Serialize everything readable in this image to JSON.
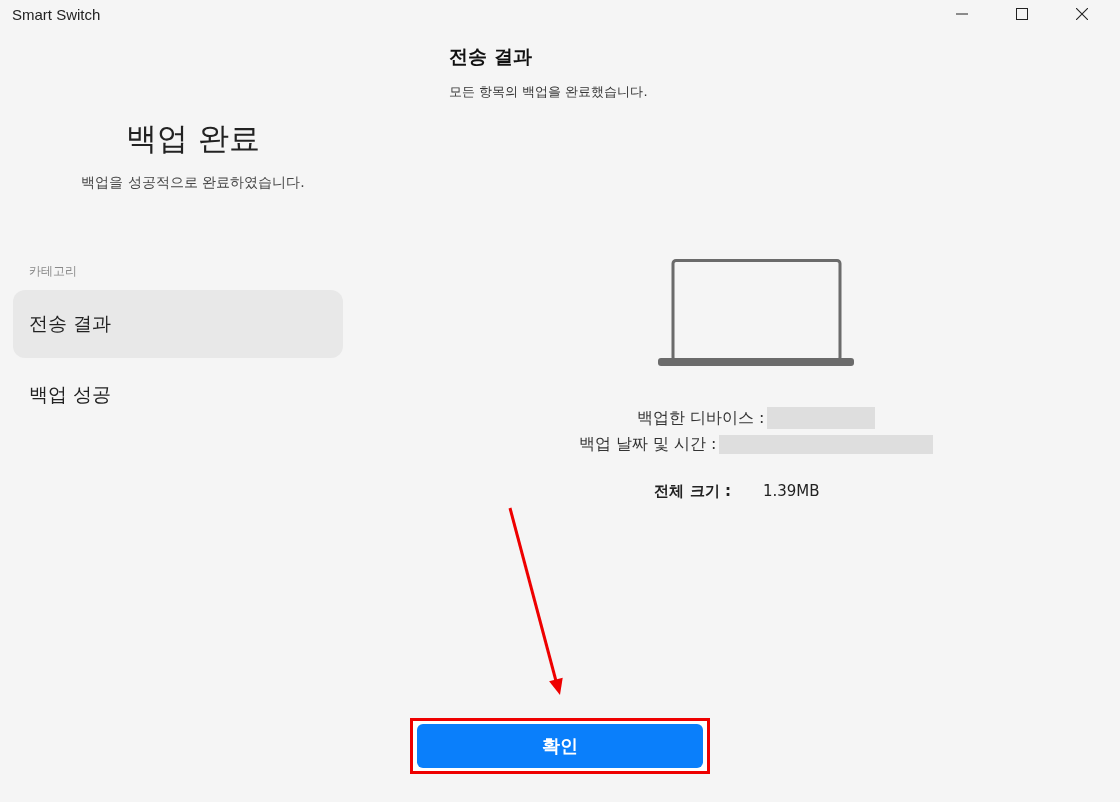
{
  "window": {
    "title": "Smart Switch"
  },
  "sidebar": {
    "heading": "백업 완료",
    "subheading": "백업을 성공적으로 완료하였습니다.",
    "category_label": "카테고리",
    "items": [
      {
        "label": "전송 결과",
        "selected": true
      },
      {
        "label": "백업 성공",
        "selected": false
      }
    ]
  },
  "main": {
    "title": "전송 결과",
    "subtitle": "모든 항목의 백업을 완료했습니다.",
    "details": [
      {
        "label": "백업한 디바이스 :",
        "redacted": true
      },
      {
        "label": "백업 날짜 및 시간 :",
        "redacted": true
      }
    ],
    "total": {
      "label": "전체 크기 :",
      "value": "1.39MB"
    }
  },
  "footer": {
    "button": "확인"
  }
}
